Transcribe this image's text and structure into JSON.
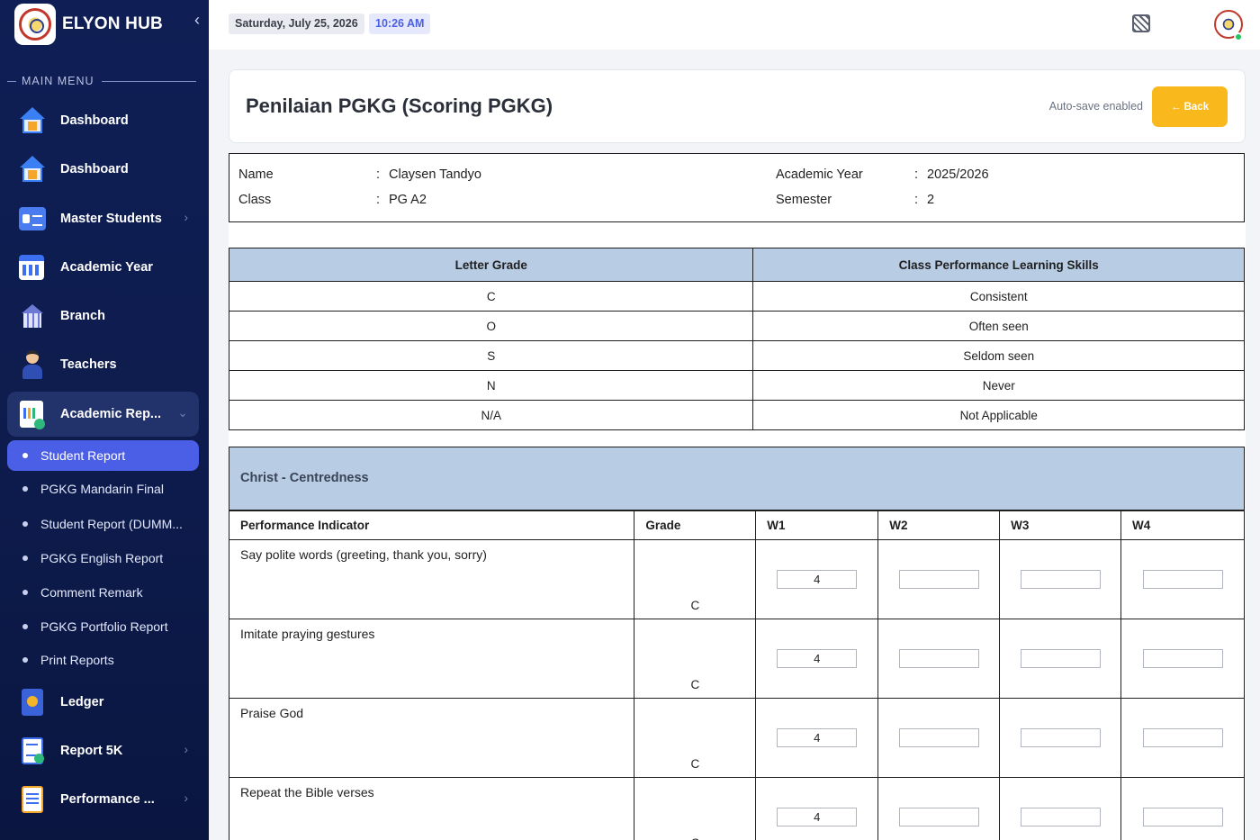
{
  "brand": {
    "name": "ELYON HUB",
    "collapse_icon": "chevron-left-icon"
  },
  "menu_header": "MAIN MENU",
  "nav": {
    "dashboard1": "Dashboard",
    "dashboard2": "Dashboard",
    "master_students": "Master Students",
    "academic_year": "Academic Year",
    "branch": "Branch",
    "teachers": "Teachers",
    "academic_reports": "Academic Rep...",
    "ledger": "Ledger",
    "report5k": "Report 5K",
    "performance": "Performance ..."
  },
  "subnav": {
    "student_report": "Student Report",
    "pgkg_mandarin_final": "PGKG Mandarin Final",
    "student_report_dummy": "Student Report (DUMM...",
    "pgkg_english_report": "PGKG English Report",
    "comment_remark": "Comment Remark",
    "pgkg_portfolio_report": "PGKG Portfolio Report",
    "print_reports": "Print Reports"
  },
  "topbar": {
    "date": "Saturday, July 25, 2026",
    "time": "10:26 AM"
  },
  "page": {
    "title": "Penilaian PGKG (Scoring PGKG)",
    "autosave": "Auto-save enabled",
    "back_label": "← Back"
  },
  "student": {
    "name_label": "Name",
    "name_value": "Claysen Tandyo",
    "class_label": "Class",
    "class_value": "PG A2",
    "year_label": "Academic Year",
    "year_value": "2025/2026",
    "semester_label": "Semester",
    "semester_value": "2",
    "colon": ":"
  },
  "legend": {
    "headers": [
      "Letter Grade",
      "Class Performance Learning Skills"
    ],
    "rows": [
      [
        "C",
        "Consistent"
      ],
      [
        "O",
        "Often seen"
      ],
      [
        "S",
        "Seldom seen"
      ],
      [
        "N",
        "Never"
      ],
      [
        "N/A",
        "Not Applicable"
      ]
    ]
  },
  "scoring": {
    "section": "Christ - Centredness",
    "headers": [
      "Performance Indicator",
      "Grade",
      "W1",
      "W2",
      "W3",
      "W4"
    ],
    "rows": [
      {
        "indicator": "Say polite words (greeting, thank you, sorry)",
        "grade": "C",
        "w1": "4",
        "w2": "",
        "w3": "",
        "w4": ""
      },
      {
        "indicator": "Imitate praying gestures",
        "grade": "C",
        "w1": "4",
        "w2": "",
        "w3": "",
        "w4": ""
      },
      {
        "indicator": "Praise God",
        "grade": "C",
        "w1": "4",
        "w2": "",
        "w3": "",
        "w4": ""
      },
      {
        "indicator": "Repeat the Bible verses",
        "grade": "C",
        "w1": "4",
        "w2": "",
        "w3": "",
        "w4": ""
      }
    ]
  },
  "colors": {
    "sidebar": "#0f1f55",
    "active": "#4b5fe6",
    "back_button": "#f9b91c",
    "table_header": "#b8cce4"
  }
}
